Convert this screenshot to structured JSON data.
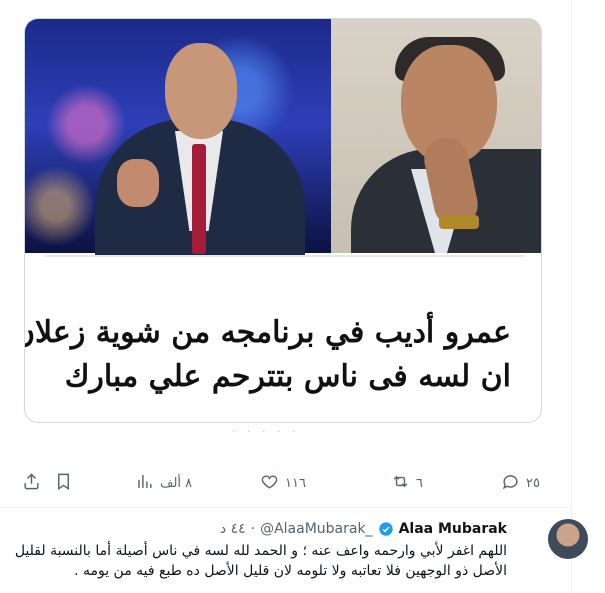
{
  "top_partial_text": "",
  "media": {
    "caption_lines": [
      "عمرو أديب في برنامجه من شوية زعلان",
      "ان لسه فى ناس بتترحم علي مبارك"
    ]
  },
  "actions": {
    "reply_count": "٢٥",
    "retweet_count": "٦",
    "like_count": "١١٦",
    "views_count": "٨ ألف"
  },
  "reply": {
    "name": "Alaa Mubarak",
    "handle": "@AlaaMubarak_",
    "separator": "·",
    "time": "٤٤ د",
    "text": "اللهم اغفر لأبي وارحمه واعف عنه ؛ و الحمد لله لسه في ناس أصيلة أما بالنسبة لقليل الأصل ذو الوجهين فلا تعاتبه ولا تلومه لان قليل الأصل ده طبع فيه من يومه ."
  },
  "colors": {
    "text_primary": "#0f1419",
    "text_secondary": "#536471",
    "verified_blue": "#1d9bf0",
    "divider": "#eff3f4"
  }
}
